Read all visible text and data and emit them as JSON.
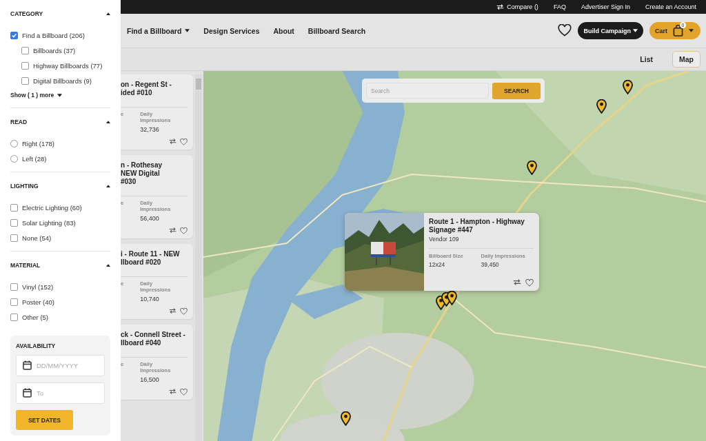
{
  "top_bar": {
    "links": [
      {
        "label": "Compare ()",
        "kind": "compare"
      },
      {
        "label": "FAQ",
        "kind": "link"
      },
      {
        "label": "Advertiser Sign In",
        "kind": "link"
      },
      {
        "label": "Create an Account",
        "kind": "link"
      }
    ]
  },
  "nav": {
    "items": [
      {
        "label": "Find a Billboard",
        "dropdown": true
      },
      {
        "label": "Design Services",
        "dropdown": false
      },
      {
        "label": "About",
        "dropdown": false
      },
      {
        "label": "Billboard Search",
        "dropdown": false
      }
    ],
    "build_campaign": "Build Campaign",
    "cart": {
      "label": "Cart",
      "count": "0"
    }
  },
  "view_toggle": [
    {
      "label": "List",
      "selected": false
    },
    {
      "label": "Map",
      "selected": true
    }
  ],
  "filters": {
    "sections": [
      {
        "title": "CATEGORY",
        "expanded": true,
        "kind": "checkbox",
        "options": [
          {
            "label": "Find a Billboard (206)",
            "checked": true,
            "children": [
              {
                "label": "Billboards (37)",
                "checked": false
              },
              {
                "label": "Highway Billboards (77)",
                "checked": false
              },
              {
                "label": "Digital Billboards (9)",
                "checked": false
              }
            ]
          }
        ],
        "show_more": "Show ( 1 ) more"
      },
      {
        "title": "READ",
        "expanded": true,
        "kind": "radio",
        "options": [
          {
            "label": "Right (178)",
            "selected": false
          },
          {
            "label": "Left (28)",
            "selected": false
          }
        ]
      },
      {
        "title": "LIGHTING",
        "expanded": true,
        "kind": "checkbox",
        "options": [
          {
            "label": "Electric Lighting (60)",
            "checked": false
          },
          {
            "label": "Solar Lighting (83)",
            "checked": false
          },
          {
            "label": "None (54)",
            "checked": false
          }
        ]
      },
      {
        "title": "MATERIAL",
        "expanded": true,
        "kind": "checkbox",
        "options": [
          {
            "label": "Vinyl (152)",
            "checked": false
          },
          {
            "label": "Poster (40)",
            "checked": false
          },
          {
            "label": "Other (5)",
            "checked": false
          }
        ]
      }
    ],
    "availability": {
      "title": "AVAILABILITY",
      "fields": [
        {
          "placeholder": "DD/MM/YYYY"
        },
        {
          "placeholder": "To"
        }
      ],
      "button": "SET DATES"
    }
  },
  "listings": [
    {
      "title_lines": [
        "on - Regent St -",
        "ided #010"
      ],
      "column_1_label": "e",
      "impressions_label": "Daily Impressions",
      "impressions": "32,736"
    },
    {
      "title_lines": [
        "n - Rothesay",
        "NEW Digital",
        "#030"
      ],
      "column_1_label": "e",
      "impressions_label": "Daily Impressions",
      "impressions": "56,400"
    },
    {
      "title_lines": [
        "i - Route 11 - NEW",
        "llboard #020"
      ],
      "column_1_label": "e",
      "impressions_label": "Daily Impressions",
      "impressions": "10,740"
    },
    {
      "title_lines": [
        "ck - Connell Street -",
        "llboard #040"
      ],
      "column_1_label": "e",
      "impressions_label": "Daily Impressions",
      "impressions": "16,500"
    }
  ],
  "map": {
    "search": {
      "placeholder": "Search",
      "button": "SEARCH"
    },
    "popup": {
      "title": "Route 1 - Hampton - Highway Signage #447",
      "vendor": "Vendor 109",
      "stats": [
        {
          "label": "Billboard Size",
          "value": "12x24"
        },
        {
          "label": "Daily Impressions",
          "value": "39,450"
        }
      ]
    }
  }
}
